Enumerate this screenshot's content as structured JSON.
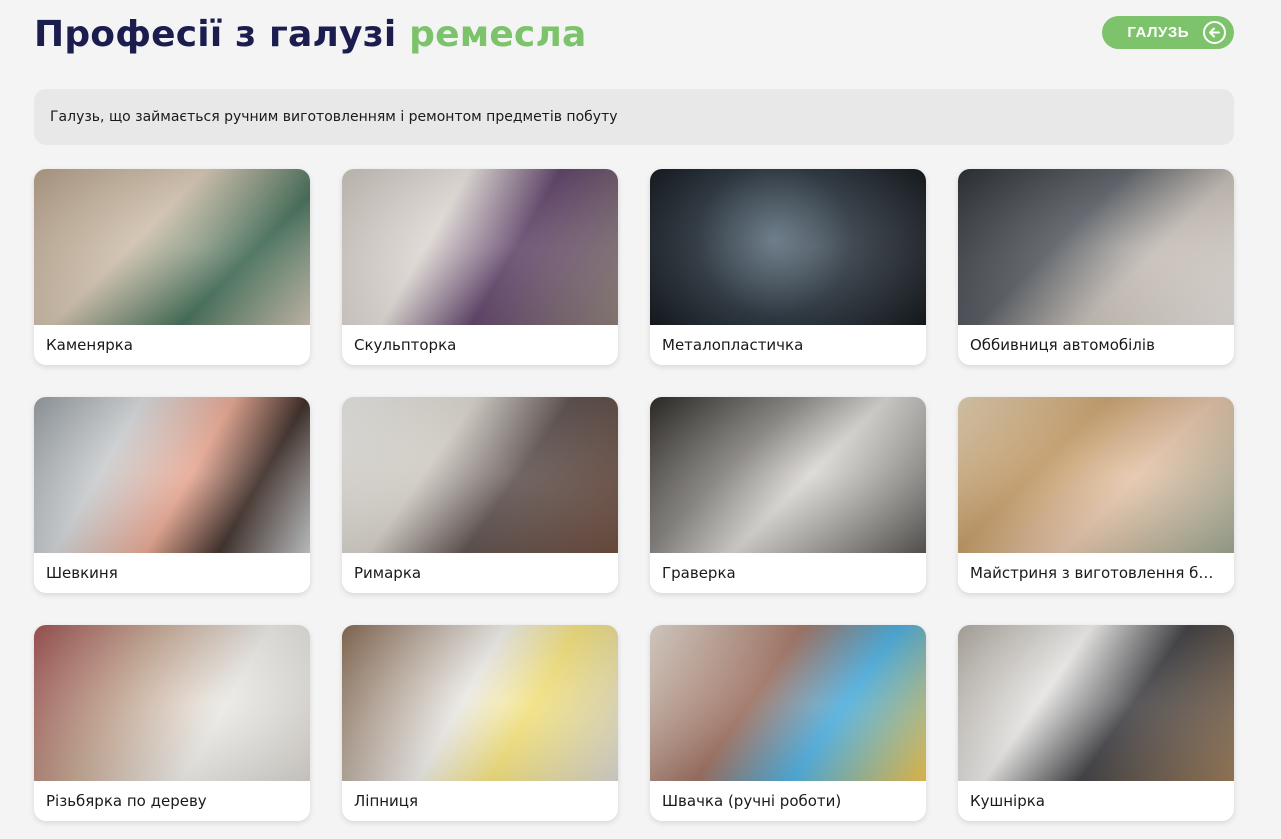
{
  "header": {
    "title_main": "Професії з галузі",
    "title_accent": "ремесла",
    "industry_button_label": "ГАЛУЗЬ",
    "industry_button_icon": "arrow-left-circle-icon"
  },
  "description": "Галузь, що займається ручним виготовленням і ремонтом предметів побуту",
  "colors": {
    "accent": "#7cc36b",
    "title": "#1c1d4f"
  },
  "professions": [
    {
      "label": "Каменярка"
    },
    {
      "label": "Скульпторка"
    },
    {
      "label": "Металопластичка"
    },
    {
      "label": "Оббивниця автомобілів"
    },
    {
      "label": "Шевкиня"
    },
    {
      "label": "Римарка"
    },
    {
      "label": "Граверка"
    },
    {
      "label": "Майстриня з виготовлення бур..."
    },
    {
      "label": "Різьбярка по дереву"
    },
    {
      "label": "Ліпниця"
    },
    {
      "label": "Швачка (ручні роботи)"
    },
    {
      "label": "Кушнірка"
    }
  ]
}
